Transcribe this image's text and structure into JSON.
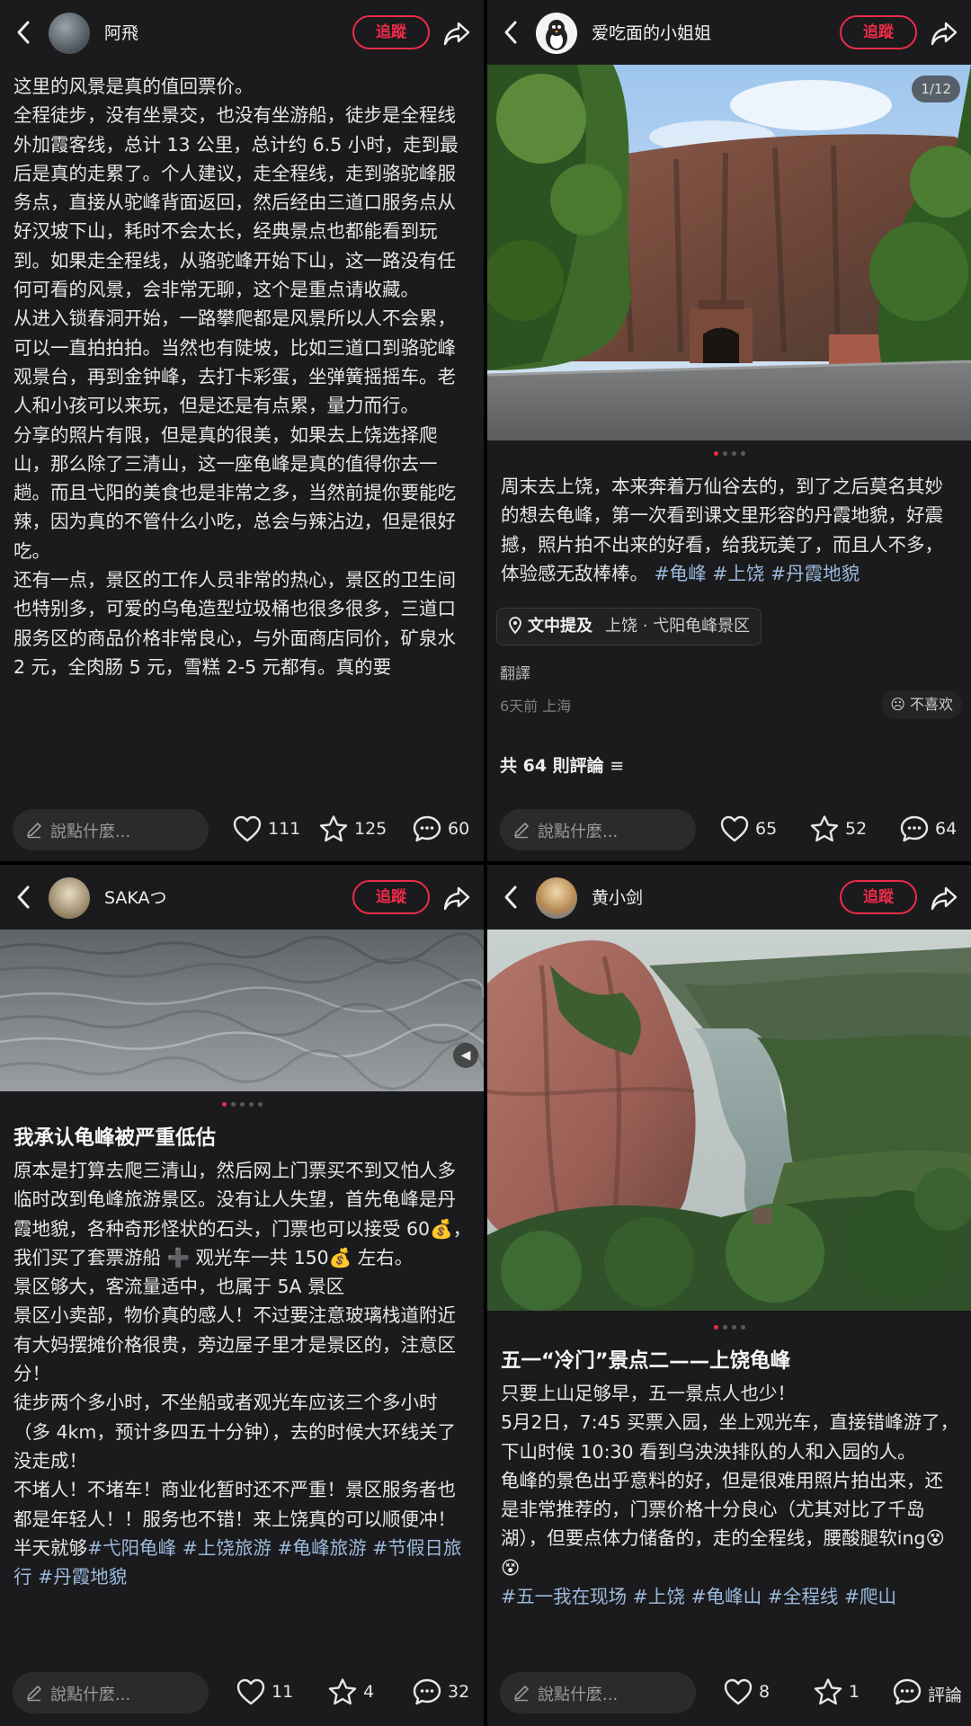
{
  "posts": [
    {
      "user": "阿飛",
      "follow_label": "追蹤",
      "body": [
        "这里的风景是真的值回票价。",
        "全程徒步，没有坐景交，也没有坐游船，徒步是全程线外加霞客线，总计 13 公里，总计约 6.5 小时，走到最后是真的走累了。个人建议，走全程线，走到骆驼峰服务点，直接从驼峰背面返回，然后经由三道口服务点从好汉坡下山，耗时不会太长，经典景点也都能看到玩到。如果走全程线，从骆驼峰开始下山，这一路没有任何可看的风景，会非常无聊，这个是重点请收藏。",
        "从进入锁春洞开始，一路攀爬都是风景所以人不会累，可以一直拍拍拍。当然也有陡坡，比如三道口到骆驼峰观景台，再到金钟峰，去打卡彩蛋，坐弹簧摇摇车。老人和小孩可以来玩，但是还是有点累，量力而行。",
        "分享的照片有限，但是真的很美，如果去上饶选择爬山，那么除了三清山，这一座龟峰是真的值得你去一趟。而且弋阳的美食也是非常之多，当然前提你要能吃辣，因为真的不管什么小吃，总会与辣沾边，但是很好吃。",
        "还有一点，景区的工作人员非常的热心，景区的卫生间也特别多，可爱的乌龟造型垃圾桶也很多很多，三道口服务区的商品价格非常良心，与外面商店同价，矿泉水 2 元，全肉肠 5 元，雪糕 2-5 元都有。真的要"
      ],
      "comment_placeholder": "說點什麼...",
      "likes": "111",
      "favorites": "125",
      "comments": "60"
    },
    {
      "user": "爱吃面的小姐姐",
      "follow_label": "追蹤",
      "counter": "1/12",
      "body": "周末去上饶，本来奔着万仙谷去的，到了之后莫名其妙的想去龟峰，第一次看到课文里形容的丹霞地貌，好震撼，照片拍不出来的好看，给我玩美了，而且人不多，体验感无敌棒棒。",
      "tags": [
        "#龟峰",
        "#上饶",
        "#丹霞地貌"
      ],
      "location_label": "文中提及",
      "location": "上饶 · 弋阳龟峰景区",
      "translate": "翻譯",
      "meta": "6天前 上海",
      "dislike": "不喜欢",
      "comment_count": "共 64 則評論",
      "comment_placeholder": "說點什麼...",
      "likes": "65",
      "favorites": "52",
      "comments": "64"
    },
    {
      "user": "SAKAつ",
      "follow_label": "追蹤",
      "title": "我承认龟峰被严重低估",
      "body": [
        "原本是打算去爬三清山，然后网上门票买不到又怕人多临时改到龟峰旅游景区。没有让人失望，首先龟峰是丹霞地貌，各种奇形怪状的石头，门票也可以接受 60💰，我们买了套票游船 ➕ 观光车一共 150💰 左右。",
        "景区够大，客流量适中，也属于 5A 景区",
        "景区小卖部，物价真的感人！不过要注意玻璃栈道附近有大妈摆摊价格很贵，旁边屋子里才是景区的，注意区分！",
        "徒步两个多小时，不坐船或者观光车应该三个多小时（多 4km，预计多四五十分钟），去的时候大环线关了没走成！",
        "不堵人！不堵车！商业化暂时还不严重！景区服务者也都是年轻人！！服务也不错！来上饶真的可以顺便冲！半天就够"
      ],
      "tags": [
        "#弋阳龟峰",
        "#上饶旅游",
        "#龟峰旅游",
        "#节假日旅行",
        "#丹霞地貌"
      ],
      "comment_placeholder": "說點什麼...",
      "likes": "11",
      "favorites": "4",
      "comments": "32"
    },
    {
      "user": "黄小剑",
      "follow_label": "追蹤",
      "title": "五一“冷门”景点二——上饶龟峰",
      "body": [
        "只要上山足够早，五一景点人也少！",
        "5月2日，7:45 买票入园，坐上观光车，直接错峰游了，下山时候 10:30 看到乌泱泱排队的人和入园的人。",
        "龟峰的景色出乎意料的好，但是很难用照片拍出来，还是非常推荐的，门票价格十分良心（尤其对比了千岛湖），但要点体力储备的，走的全程线，腰酸腿软ing😵😵"
      ],
      "tags": [
        "#五一我在现场",
        "#上饶",
        "#龟峰山",
        "#全程线",
        "#爬山"
      ],
      "comment_placeholder": "說點什麼...",
      "likes": "8",
      "favorites": "1",
      "comments": "評論"
    }
  ],
  "colors": {
    "accent": "#ee2b49",
    "tag": "#9bb9dc",
    "panel": "#1b1b1d"
  },
  "icons": [
    "back-icon",
    "share-icon",
    "pen-icon",
    "heart-icon",
    "star-icon",
    "comment-icon",
    "location-icon",
    "mute-icon"
  ]
}
